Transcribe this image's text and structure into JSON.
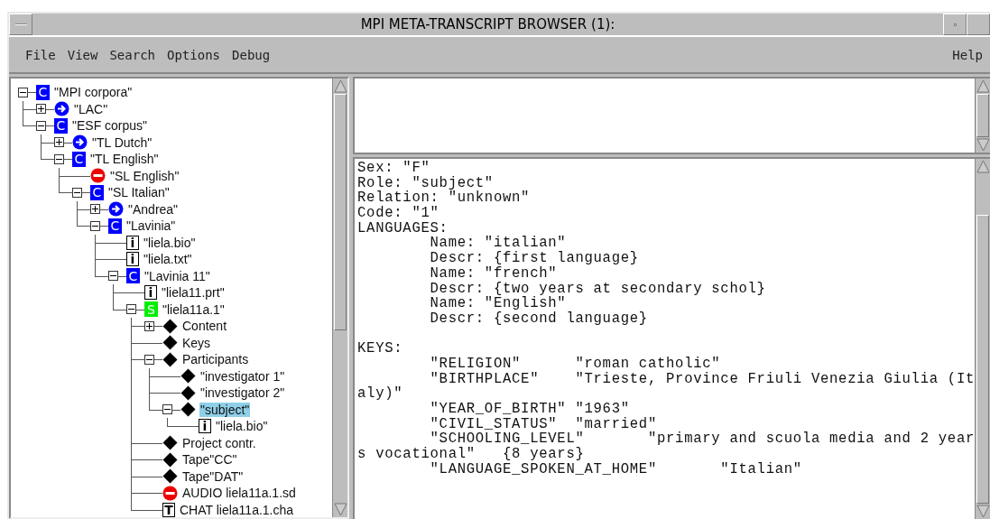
{
  "window": {
    "title": "MPI META-TRANSCRIPT BROWSER (1):"
  },
  "menu": {
    "left": [
      {
        "label": "File"
      },
      {
        "label": "View"
      },
      {
        "label": "Search"
      },
      {
        "label": "Options"
      },
      {
        "label": "Debug"
      }
    ],
    "right": [
      {
        "label": "Help"
      }
    ]
  },
  "tree": [
    {
      "label": "\"MPI corpora\"",
      "kind": "corpus",
      "badge": "C",
      "expanded": true,
      "selected": false,
      "children": [
        {
          "label": "\"LAC\"",
          "kind": "link",
          "expanded": false,
          "selected": false
        },
        {
          "label": "\"ESF corpus\"",
          "kind": "corpus",
          "badge": "C",
          "expanded": true,
          "selected": false,
          "children": [
            {
              "label": "\"TL Dutch\"",
              "kind": "link",
              "expanded": false,
              "selected": false
            },
            {
              "label": "\"TL English\"",
              "kind": "corpus",
              "badge": "C",
              "expanded": true,
              "selected": false,
              "children": [
                {
                  "label": "\"SL English\"",
                  "kind": "blocked",
                  "selected": false
                },
                {
                  "label": "\"SL Italian\"",
                  "kind": "corpus",
                  "badge": "C",
                  "expanded": true,
                  "selected": false,
                  "children": [
                    {
                      "label": "\"Andrea\"",
                      "kind": "link",
                      "expanded": false,
                      "selected": false
                    },
                    {
                      "label": "\"Lavinia\"",
                      "kind": "corpus",
                      "badge": "C",
                      "expanded": true,
                      "selected": false,
                      "children": [
                        {
                          "label": "\"liela.bio\"",
                          "kind": "info",
                          "badge": "i",
                          "selected": false
                        },
                        {
                          "label": "\"liela.txt\"",
                          "kind": "info",
                          "badge": "i",
                          "selected": false
                        },
                        {
                          "label": "\"Lavinia 11\"",
                          "kind": "corpus",
                          "badge": "C",
                          "expanded": true,
                          "selected": false,
                          "children": [
                            {
                              "label": "\"liela11.prt\"",
                              "kind": "info",
                              "badge": "i",
                              "selected": false
                            },
                            {
                              "label": "\"liela11a.1\"",
                              "kind": "session",
                              "badge": "S",
                              "expanded": true,
                              "selected": false,
                              "children": [
                                {
                                  "label": "Content",
                                  "kind": "node",
                                  "expanded": false,
                                  "selected": false
                                },
                                {
                                  "label": "Keys",
                                  "kind": "node",
                                  "selected": false
                                },
                                {
                                  "label": "Participants",
                                  "kind": "node",
                                  "expanded": true,
                                  "selected": false,
                                  "children": [
                                    {
                                      "label": "\"investigator 1\"",
                                      "kind": "node",
                                      "selected": false
                                    },
                                    {
                                      "label": "\"investigator 2\"",
                                      "kind": "node",
                                      "selected": false
                                    },
                                    {
                                      "label": "\"subject\"",
                                      "kind": "node",
                                      "expanded": true,
                                      "selected": true,
                                      "children": [
                                        {
                                          "label": "\"liela.bio\"",
                                          "kind": "info",
                                          "badge": "i",
                                          "selected": false
                                        }
                                      ]
                                    }
                                  ]
                                },
                                {
                                  "label": "Project contr.",
                                  "kind": "node",
                                  "selected": false
                                },
                                {
                                  "label": "Tape\"CC\"",
                                  "kind": "node",
                                  "selected": false
                                },
                                {
                                  "label": "Tape\"DAT\"",
                                  "kind": "node",
                                  "selected": false
                                },
                                {
                                  "label": "AUDIO liela11a.1.sd",
                                  "kind": "blocked",
                                  "selected": false
                                },
                                {
                                  "label": "CHAT liela11a.1.cha",
                                  "kind": "info",
                                  "badge": "T",
                                  "selected": false
                                }
                              ]
                            }
                          ]
                        }
                      ]
                    }
                  ]
                }
              ]
            }
          ]
        }
      ]
    }
  ],
  "details": {
    "sections": [
      {
        "lines": [
          "Sex: \"F\"",
          "Role: \"subject\"",
          "Relation: \"unknown\"",
          "Code: \"1\"",
          "LANGUAGES:",
          "        Name: \"italian\"",
          "        Descr: {first language}",
          "        Name: \"french\"",
          "        Descr: {two years at secondary schol}",
          "        Name: \"English\"",
          "        Descr: {second language}"
        ]
      },
      {
        "lines": [
          "KEYS:",
          "        \"RELIGION\"      \"roman catholic\"",
          "        \"BIRTHPLACE\"    \"Trieste, Province Friuli Venezia Giulia (It",
          "aly)\"",
          "        \"YEAR_OF_BIRTH\" \"1963\"",
          "        \"CIVIL_STATUS\"  \"married\"",
          "        \"SCHOOLING_LEVEL\"       \"primary and scuola media and 2 year",
          "s vocational\"   {8 years}",
          "        \"LANGUAGE_SPOKEN_AT_HOME\"       \"Italian\""
        ]
      }
    ]
  }
}
